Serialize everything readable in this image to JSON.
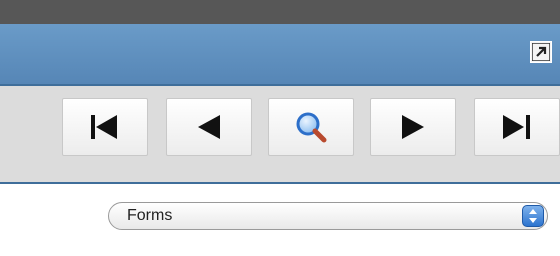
{
  "toolbar": {
    "buttons": [
      {
        "icon": "first-page-icon"
      },
      {
        "icon": "previous-icon"
      },
      {
        "icon": "search-icon"
      },
      {
        "icon": "next-icon"
      },
      {
        "icon": "last-page-icon"
      }
    ]
  },
  "window": {
    "expand_icon": "expand-icon"
  },
  "select": {
    "value": "Forms"
  },
  "colors": {
    "title_bar": "#5686b6",
    "toolbar_bg": "#dcdcdc",
    "accent_blue": "#2d74cf"
  }
}
